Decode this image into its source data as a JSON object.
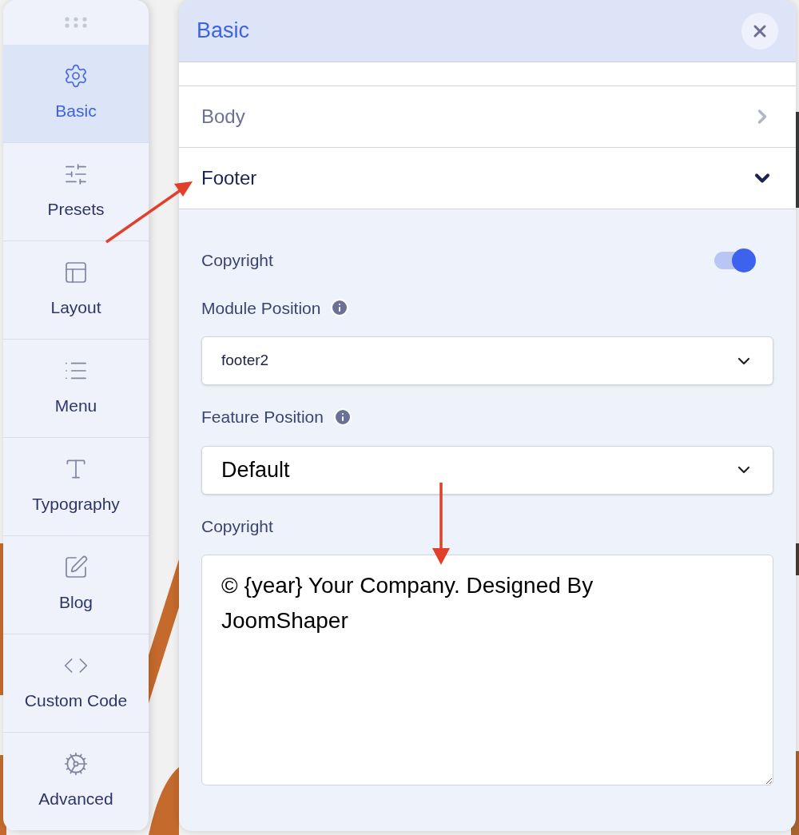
{
  "sidebar": {
    "items": [
      {
        "label": "Basic",
        "kind": "gear",
        "selected": true
      },
      {
        "label": "Presets",
        "kind": "sliders",
        "selected": false
      },
      {
        "label": "Layout",
        "kind": "layout",
        "selected": false
      },
      {
        "label": "Menu",
        "kind": "list",
        "selected": false
      },
      {
        "label": "Typography",
        "kind": "type",
        "selected": false
      },
      {
        "label": "Blog",
        "kind": "pen",
        "selected": false
      },
      {
        "label": "Custom Code",
        "kind": "code",
        "selected": false
      },
      {
        "label": "Advanced",
        "kind": "cogs",
        "selected": false
      }
    ]
  },
  "panel": {
    "title": "Basic",
    "sections": [
      {
        "label": "Body",
        "expanded": false
      },
      {
        "label": "Footer",
        "expanded": true
      }
    ],
    "fields": [
      {
        "kind": "toggle",
        "label": "Copyright",
        "on": true
      },
      {
        "kind": "select",
        "label": "Module Position",
        "info": true,
        "value": "footer2"
      },
      {
        "kind": "native-select",
        "label": "Feature Position",
        "info": true,
        "value": "Default"
      },
      {
        "kind": "textarea",
        "label": "Copyright",
        "value": "© {year} Your Company. Designed By JoomShaper"
      }
    ]
  }
}
